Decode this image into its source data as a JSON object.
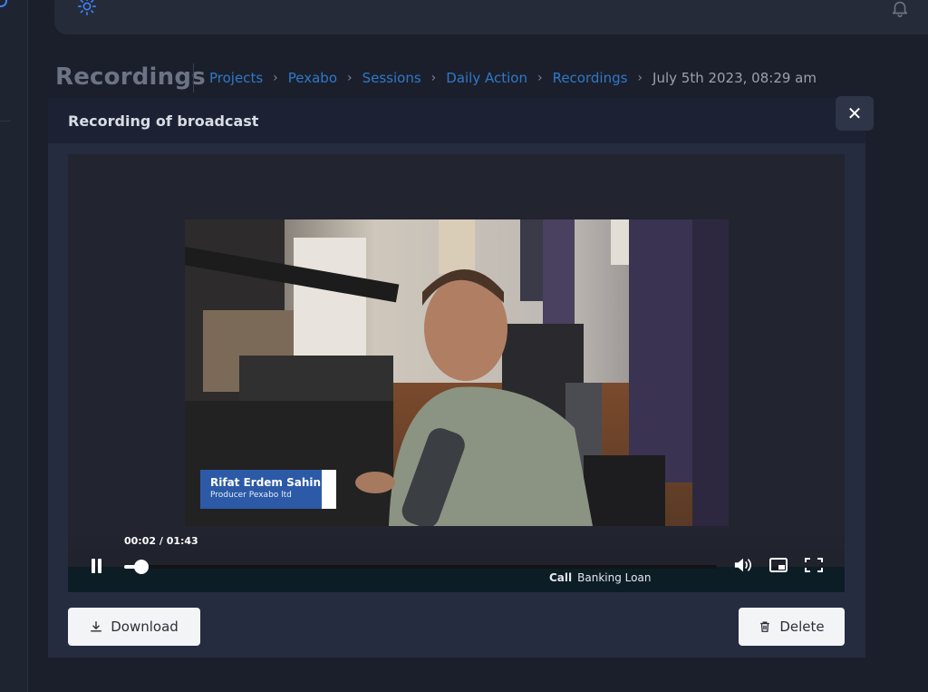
{
  "page": {
    "title": "Recordings"
  },
  "breadcrumb": {
    "items": [
      "Projects",
      "Pexabo",
      "Sessions",
      "Daily Action",
      "Recordings"
    ],
    "current": "July 5th 2023, 08:29 am"
  },
  "header": {
    "icons": [
      "sun-icon",
      "bell-icon"
    ]
  },
  "modal": {
    "title": "Recording of broadcast",
    "close_label": "✕"
  },
  "player": {
    "time_current": "00:02",
    "time_total": "01:43",
    "time_display": "00:02 / 01:43",
    "progress_fraction": 0.02,
    "state": "playing",
    "chapter_prefix": "Call",
    "chapter_title": "Banking Loan",
    "nameplate": {
      "name": "Rifat Erdem Sahin",
      "role": "Producer Pexabo ltd"
    },
    "icons": [
      "pause-icon",
      "volume-icon",
      "picture-in-picture-icon",
      "fullscreen-icon"
    ]
  },
  "actions": {
    "download_label": "Download",
    "delete_label": "Delete"
  },
  "colors": {
    "background": "#1b1f2b",
    "link": "#2f78c9",
    "modal": "#262c3f",
    "modal_header": "#1c2233",
    "nameplate": "#2c5aa7"
  }
}
